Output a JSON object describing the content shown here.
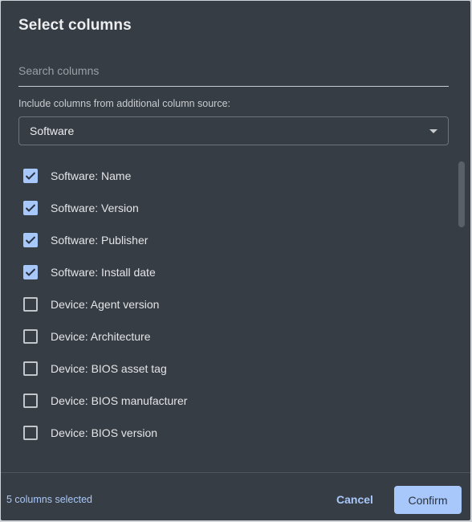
{
  "dialog": {
    "title": "Select columns"
  },
  "search": {
    "placeholder": "Search columns",
    "value": ""
  },
  "column_source": {
    "label": "Include columns from additional column source:",
    "selected": "Software",
    "icon": "caret-down-icon"
  },
  "columns": [
    {
      "label": "Software: Name",
      "checked": true
    },
    {
      "label": "Software: Version",
      "checked": true
    },
    {
      "label": "Software: Publisher",
      "checked": true
    },
    {
      "label": "Software: Install date",
      "checked": true
    },
    {
      "label": "Device: Agent version",
      "checked": false
    },
    {
      "label": "Device: Architecture",
      "checked": false
    },
    {
      "label": "Device: BIOS asset tag",
      "checked": false
    },
    {
      "label": "Device: BIOS manufacturer",
      "checked": false
    },
    {
      "label": "Device: BIOS version",
      "checked": false
    }
  ],
  "footer": {
    "status": "5 columns selected",
    "cancel_label": "Cancel",
    "confirm_label": "Confirm"
  },
  "colors": {
    "background": "#373d44",
    "accent": "#a8c7fa",
    "text": "#e3e5e8"
  }
}
